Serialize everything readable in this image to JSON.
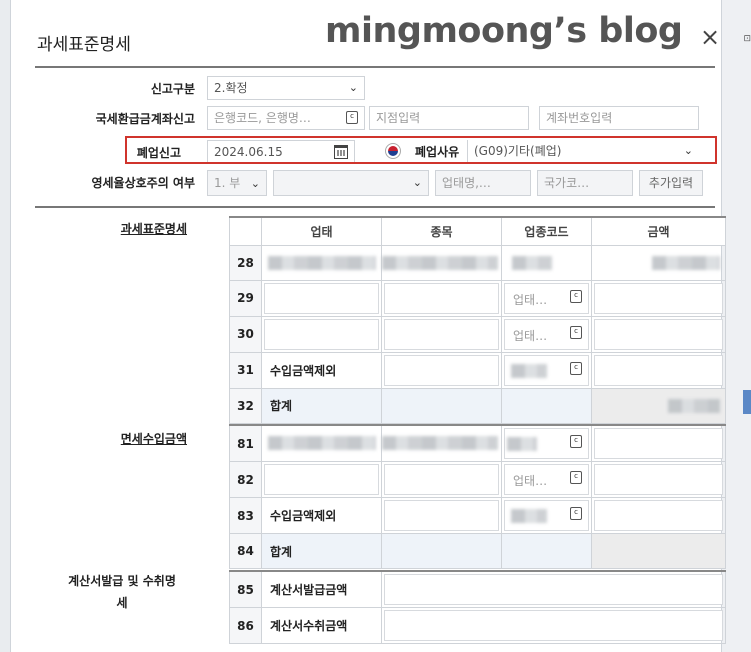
{
  "dialog": {
    "title": "과세표준명세",
    "watermark": "mingmoong’s blog",
    "close_glyph": "×"
  },
  "form": {
    "report_type": {
      "label": "신고구분",
      "value": "2.확정"
    },
    "refund_account": {
      "label": "국세환급금계좌신고",
      "bank_placeholder": "은행코드, 은행명…",
      "branch_placeholder": "지점입력",
      "account_placeholder": "계좌번호입력"
    },
    "closure": {
      "label": "폐업신고",
      "date": "2024.06.15",
      "reason_label": "폐업사유",
      "reason_value": "(G09)기타(폐업)"
    },
    "zero_rate": {
      "label": "영세율상호주의 여부",
      "value": "1. 부",
      "business_placeholder": "업태명,…",
      "country_placeholder": "국가코…",
      "add_button": "추가입력"
    }
  },
  "tax_base": {
    "section_label": "과세표준명세",
    "columns": [
      "업태",
      "종목",
      "업종코드",
      "금액"
    ],
    "rows": [
      {
        "no": "28",
        "label": ""
      },
      {
        "no": "29",
        "label": "",
        "code_placeholder": "업태…"
      },
      {
        "no": "30",
        "label": "",
        "code_placeholder": "업태…"
      },
      {
        "no": "31",
        "label": "수입금액제외"
      },
      {
        "no": "32",
        "label": "합계"
      }
    ]
  },
  "tax_free": {
    "section_label": "면세수입금액",
    "rows": [
      {
        "no": "81",
        "label": ""
      },
      {
        "no": "82",
        "label": "",
        "code_placeholder": "업태…"
      },
      {
        "no": "83",
        "label": "수입금액제외"
      },
      {
        "no": "84",
        "label": "합계"
      }
    ]
  },
  "invoice": {
    "section_label_1": "계산서발급 및 수취명",
    "section_label_2": "세",
    "rows": [
      {
        "no": "85",
        "label": "계산서발급금액"
      },
      {
        "no": "86",
        "label": "계산서수취금액"
      }
    ]
  },
  "icons": {
    "chevron": "⌄",
    "code_lookup": "c"
  },
  "colors": {
    "highlight_border": "#d0342c",
    "total_row_bg": "#eef3f9"
  }
}
